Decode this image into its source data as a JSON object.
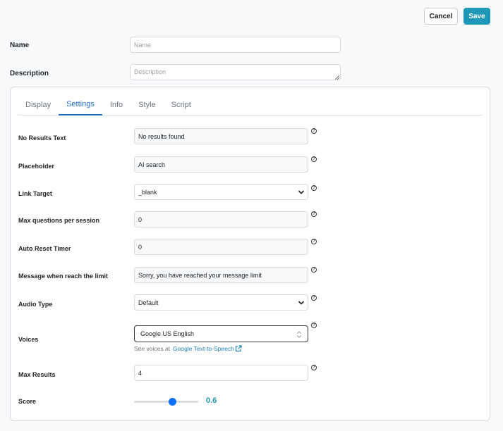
{
  "toolbar": {
    "cancel_label": "Cancel",
    "save_label": "Save"
  },
  "form": {
    "name": {
      "label": "Name",
      "placeholder": "Name"
    },
    "description": {
      "label": "Description",
      "placeholder": "Description"
    }
  },
  "tabs": [
    {
      "label": "Display",
      "active": false
    },
    {
      "label": "Settings",
      "active": true
    },
    {
      "label": "Info",
      "active": false
    },
    {
      "label": "Style",
      "active": false
    },
    {
      "label": "Script",
      "active": false
    }
  ],
  "settings": {
    "no_results_text": {
      "label": "No Results Text",
      "value": "No results found"
    },
    "placeholder": {
      "label": "Placeholder",
      "value": "AI search"
    },
    "link_target": {
      "label": "Link Target",
      "value": "_blank"
    },
    "max_questions": {
      "label": "Max questions per session",
      "value": "0"
    },
    "auto_reset_timer": {
      "label": "Auto Reset Timer",
      "value": "0"
    },
    "limit_message": {
      "label": "Message when reach the limit",
      "value": "Sorry, you have reached your message limit"
    },
    "audio_type": {
      "label": "Audio Type",
      "value": "Default"
    },
    "voices": {
      "label": "Voices",
      "value": "Google US English",
      "hint_prefix": "See voices at",
      "hint_link": "Google Text-to-Speech"
    },
    "max_results": {
      "label": "Max Results",
      "value": "4"
    },
    "score": {
      "label": "Score",
      "value": "0.6",
      "fraction": 0.6
    }
  },
  "help_glyph": "?",
  "icons": [
    "question-circle-icon",
    "chevron-down-icon",
    "updown-chevron-icon",
    "external-link-icon"
  ],
  "colors": {
    "accent": "#1f97b7",
    "tab_active": "#1f6fc6",
    "slider": "#0b6efd",
    "link": "#1f7fb5"
  }
}
